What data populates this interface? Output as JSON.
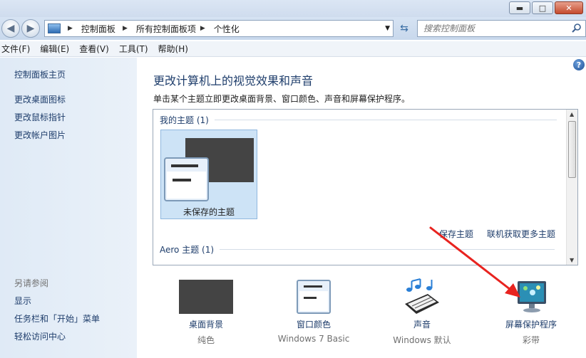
{
  "window": {
    "minimize_glyph": "▬",
    "maximize_glyph": "□",
    "close_glyph": "✕"
  },
  "address_bar": {
    "crumbs": [
      "控制面板",
      "所有控制面板项",
      "个性化"
    ]
  },
  "search": {
    "placeholder": "搜索控制面板"
  },
  "menu": {
    "items": [
      "文件(F)",
      "编辑(E)",
      "查看(V)",
      "工具(T)",
      "帮助(H)"
    ]
  },
  "sidebar": {
    "home": "控制面板主页",
    "links": [
      "更改桌面图标",
      "更改鼠标指针",
      "更改帐户图片"
    ],
    "see_also": "另请参阅",
    "see_also_links": [
      "显示",
      "任务栏和「开始」菜单",
      "轻松访问中心"
    ]
  },
  "main": {
    "title": "更改计算机上的视觉效果和声音",
    "description": "单击某个主题立即更改桌面背景、窗口颜色、声音和屏幕保护程序。",
    "my_themes_header": "我的主题 (1)",
    "unsaved_theme": "未保存的主题",
    "save_theme": "保存主题",
    "get_more_themes": "联机获取更多主题",
    "aero_header": "Aero 主题 (1)"
  },
  "options": {
    "background": {
      "label": "桌面背景",
      "sub": "纯色"
    },
    "color": {
      "label": "窗口颜色",
      "sub": "Windows 7 Basic"
    },
    "sound": {
      "label": "声音",
      "sub": "Windows 默认"
    },
    "screensaver": {
      "label": "屏幕保护程序",
      "sub": "彩带"
    }
  },
  "colors": {
    "link": "#1e3d6b",
    "annotation_arrow": "#e8231f"
  }
}
